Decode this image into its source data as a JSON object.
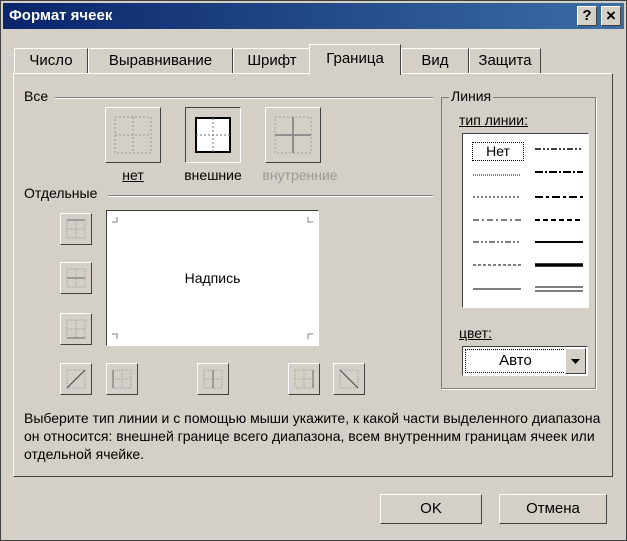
{
  "window": {
    "title": "Формат ячеек",
    "help_button": "?",
    "close_button": "×"
  },
  "tabs": [
    "Число",
    "Выравнивание",
    "Шрифт",
    "Граница",
    "Вид",
    "Защита"
  ],
  "active_tab": "Граница",
  "presets": {
    "group_label": "Все",
    "none_label": "нет",
    "outline_label": "внешние",
    "inside_label": "внутренние"
  },
  "individual": {
    "group_label": "Отдельные",
    "preview_text": "Надпись"
  },
  "line": {
    "group_label": "Линия",
    "style_label": "тип линии:",
    "none_style": "Нет",
    "color_label": "цвет:",
    "color_value": "Авто"
  },
  "description": "Выберите тип линии и с помощью мыши укажите, к какой части выделенного диапазона он относится: внешней границе всего диапазона, всем внутренним границам ячеек или отдельной ячейке.",
  "buttons": {
    "ok": "OK",
    "cancel": "Отмена"
  }
}
